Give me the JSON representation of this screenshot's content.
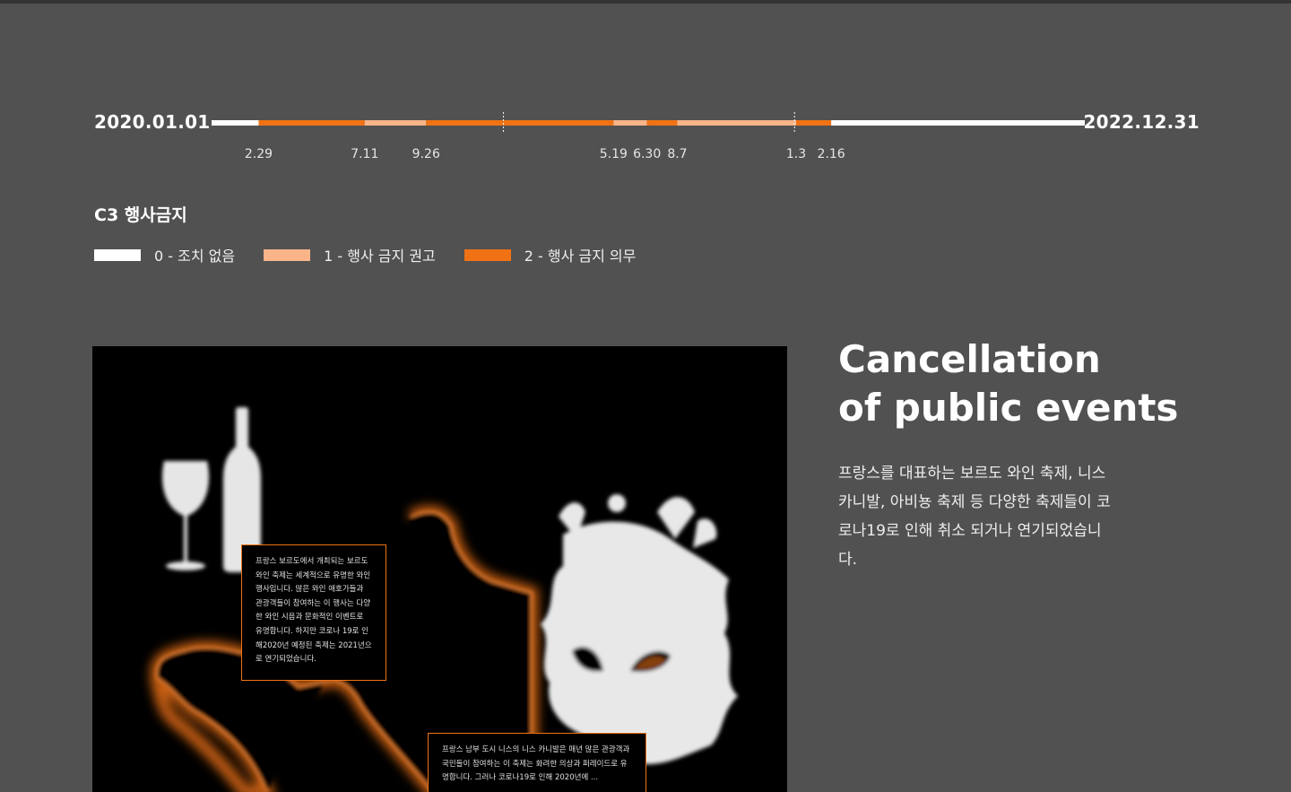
{
  "timeline": {
    "start_label": "2020.01.01",
    "end_label": "2022.12.31",
    "tick_labels": [
      "2.29",
      "7.11",
      "9.26",
      "5.19",
      "6.30",
      "8.7",
      "1.3",
      "2.16"
    ],
    "segments": [
      {
        "from": "2020-01-01",
        "to": "2020-02-29",
        "level": 0
      },
      {
        "from": "2020-02-29",
        "to": "2020-07-11",
        "level": 2
      },
      {
        "from": "2020-07-11",
        "to": "2020-09-26",
        "level": 1
      },
      {
        "from": "2020-09-26",
        "to": "2021-05-19",
        "level": 2
      },
      {
        "from": "2021-05-19",
        "to": "2021-06-30",
        "level": 1
      },
      {
        "from": "2021-06-30",
        "to": "2021-08-07",
        "level": 2
      },
      {
        "from": "2021-08-07",
        "to": "2022-01-03",
        "level": 1
      },
      {
        "from": "2022-01-03",
        "to": "2022-02-16",
        "level": 2
      },
      {
        "from": "2022-02-16",
        "to": "2022-12-31",
        "level": 0
      }
    ],
    "year_markers": [
      "2021-01-01",
      "2022-01-01"
    ]
  },
  "legend": {
    "title": "C3 행사금지",
    "items": [
      {
        "label": "0 - 조치 없음",
        "color": "#ffffff"
      },
      {
        "label": "1 - 행사 금지 권고",
        "color": "#f9b48a"
      },
      {
        "label": "2 - 행사 금지 의무",
        "color": "#f07215"
      }
    ]
  },
  "panel": {
    "bordeaux_text": "프랑스 보르도에서 개최되는 보르도 와인 축제는 세계적으로 유명한 와인 행사입니다. 많은 와인 애호가들과 관광객들이 참여하는 이 행사는 다양한 와인 시음과 문화적인 이벤트로 유명합니다. 하지만 코로나 19로 인해2020년 예정된 축제는 2021년으로 연기되었습니다.",
    "nice_text": "프랑스 남부 도시 니스의 니스 카니발은 매년 많은 관광객과 국민들이 참여하는 이 축제는 화려한 의상과 퍼레이드로 유명합니다. 그러나 코로나19로 인해 2020년에 ..."
  },
  "heading": {
    "line1": "Cancellation",
    "line2": "of public events"
  },
  "body": {
    "text": "프랑스를  대표하는 보르도 와인 축제, 니스 카니발, 아비뇽 축제 등 다양한 축제들이 코로나19로 인해 취소 되거나 연기되었습니다."
  },
  "colors": {
    "level0": "#ffffff",
    "level1": "#f9b48a",
    "level2": "#f07215",
    "background": "#515151"
  }
}
